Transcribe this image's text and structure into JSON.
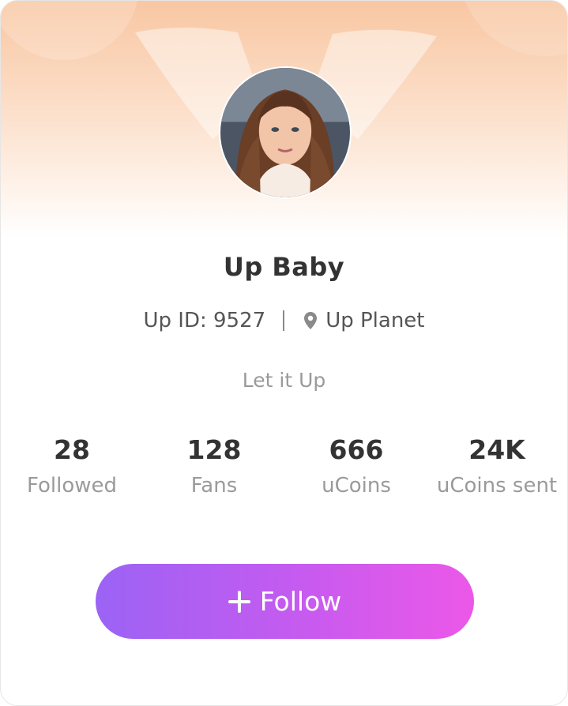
{
  "profile": {
    "name": "Up Baby",
    "id_label": "Up ID: 9527",
    "location": "Up Planet",
    "bio": "Let it Up"
  },
  "stats": [
    {
      "value": "28",
      "label": "Followed"
    },
    {
      "value": "128",
      "label": "Fans"
    },
    {
      "value": "666",
      "label": "uCoins"
    },
    {
      "value": "24K",
      "label": "uCoins sent"
    }
  ],
  "follow_button": {
    "label": "Follow"
  },
  "colors": {
    "banner_top": "#f8c7a3",
    "button_start": "#9b63f4",
    "button_end": "#ec58e8",
    "text_primary": "#333333",
    "text_secondary": "#9a9a9a"
  },
  "icons": {
    "location": "location-pin-icon",
    "follow": "plus-icon"
  }
}
